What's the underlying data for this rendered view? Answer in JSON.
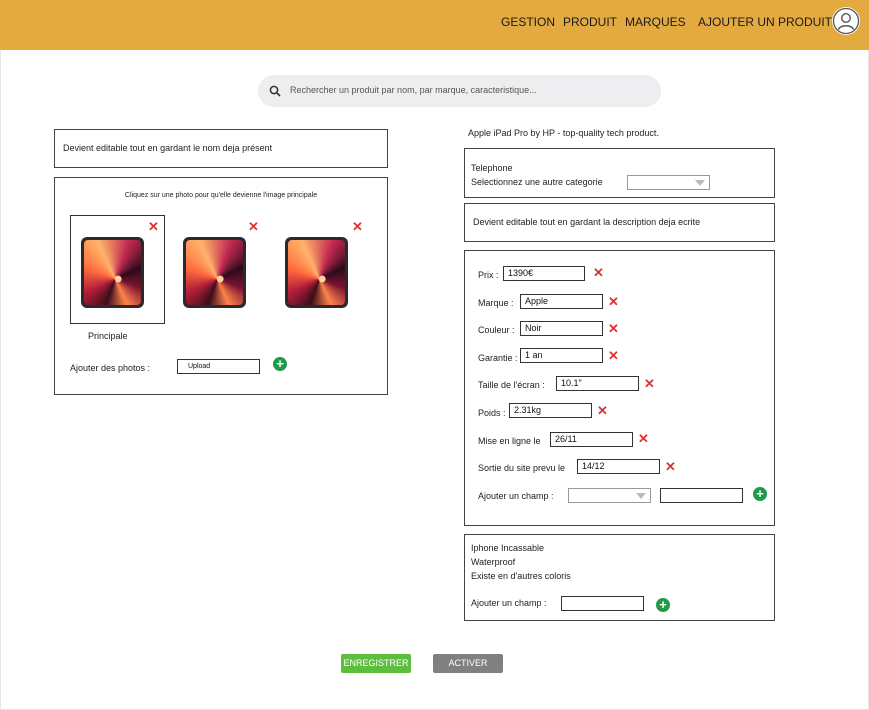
{
  "nav": {
    "items": [
      "GESTION",
      "PRODUIT",
      "MARQUES",
      "AJOUTER UN PRODUIT"
    ]
  },
  "search": {
    "placeholder": "Rechercher un produit par nom, par marque, caracteristique..."
  },
  "left": {
    "name_box": "Devient editable tout en gardant le nom deja présent",
    "photo_hint": "Cliquez sur une photo pour qu'elle devienne l'image principale",
    "principal_label": "Principale",
    "add_photos_label": "Ajouter des photos :",
    "upload_label": "Upload"
  },
  "right": {
    "title": "Apple iPad Pro by HP - top-quality tech product.",
    "category": "Telephone",
    "category_prompt": "Selectionnez une autre categorie",
    "description_box": "Devient editable tout en gardant la description deja ecrite",
    "specs": [
      {
        "label": "Prix :",
        "value": "1390€"
      },
      {
        "label": "Marque :",
        "value": "Apple"
      },
      {
        "label": "Couleur :",
        "value": "Noir"
      },
      {
        "label": "Garantie :",
        "value": "1 an"
      },
      {
        "label": "Taille de l'écran :",
        "value": "10.1\""
      },
      {
        "label": "Poids :",
        "value": "2.31kg"
      },
      {
        "label": "Mise en ligne le",
        "value": "26/11"
      },
      {
        "label": "Sortie du site prevu le",
        "value": "14/12"
      }
    ],
    "add_field_label": "Ajouter un champ :",
    "features": [
      "Iphone Incassable",
      "Waterproof",
      "Existe en d'autres coloris"
    ],
    "add_feature_label": "Ajouter un champ :"
  },
  "buttons": {
    "save": "ENREGISTRER",
    "activate": "ACTIVER"
  },
  "colors": {
    "topbar": "#E3AA40",
    "save": "#5DBE3E",
    "activate": "#808080",
    "remove": "#DD3333",
    "add": "#1E9A4A"
  }
}
